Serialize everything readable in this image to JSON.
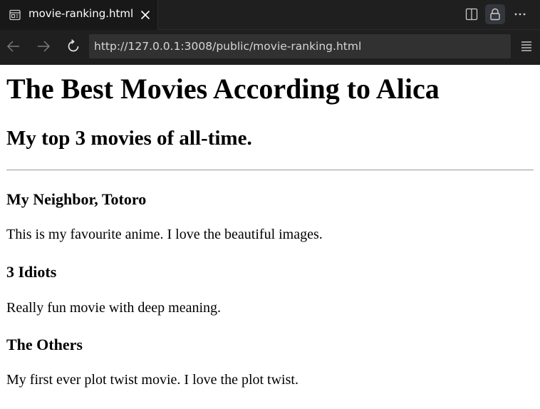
{
  "tab": {
    "title": "movie-ranking.html",
    "icon": "preview-icon"
  },
  "toolbar": {
    "icons": [
      "split-editor-icon",
      "lock-icon",
      "more-icon"
    ]
  },
  "nav": {
    "url": "http://127.0.0.1:3008/public/movie-ranking.html",
    "icons": [
      "back-arrow-icon",
      "forward-arrow-icon",
      "reload-icon",
      "menu-icon"
    ]
  },
  "page": {
    "heading": "The Best Movies According to Alica",
    "subheading": "My top 3 movies of all-time.",
    "movies": [
      {
        "title": "My Neighbor, Totoro",
        "description": "This is my favourite anime. I love the beautiful images."
      },
      {
        "title": "3 Idiots",
        "description": "Really fun movie with deep meaning."
      },
      {
        "title": "The Others",
        "description": "My first ever plot twist movie. I love the plot twist."
      }
    ]
  },
  "colors": {
    "chrome_background": "#1f1f1f",
    "active_tab": "#181818",
    "url_field": "#313131",
    "url_text": "#d6d6d6",
    "page_background": "#ffffff"
  }
}
